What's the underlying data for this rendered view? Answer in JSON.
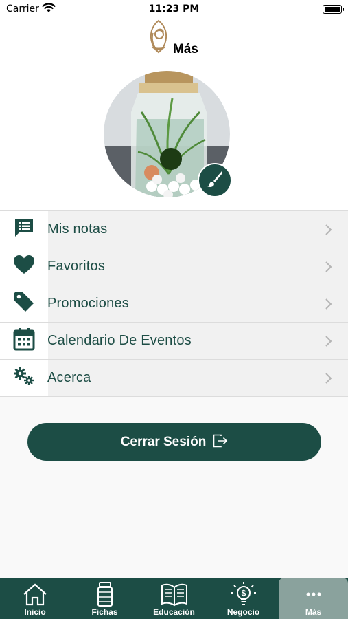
{
  "status_bar": {
    "carrier": "Carrier",
    "time": "11:23 PM"
  },
  "header": {
    "logo_icon": "brand-leaf-logo",
    "title": "Más"
  },
  "profile": {
    "avatar_icon": "profile-photo",
    "edit_icon": "paintbrush-icon"
  },
  "menu": {
    "items": [
      {
        "label": "Mis notas",
        "icon": "notes-icon"
      },
      {
        "label": "Favoritos",
        "icon": "heart-icon"
      },
      {
        "label": "Promociones",
        "icon": "tag-icon"
      },
      {
        "label": "Calendario De Eventos",
        "icon": "calendar-icon"
      },
      {
        "label": "Acerca",
        "icon": "gears-icon"
      }
    ]
  },
  "logout": {
    "label": "Cerrar Sesión",
    "icon": "logout-icon"
  },
  "tabs": [
    {
      "label": "Inicio",
      "icon": "home-icon"
    },
    {
      "label": "Fichas",
      "icon": "bottle-icon"
    },
    {
      "label": "Educación",
      "icon": "book-icon"
    },
    {
      "label": "Negocio",
      "icon": "lightbulb-dollar-icon"
    },
    {
      "label": "Más",
      "icon": "more-icon",
      "active": true
    }
  ],
  "colors": {
    "primary": "#1c4d45",
    "active_tab": "#8aa29d",
    "menu_row_bg": "#f1f1f1",
    "logo_gold": "#b08a5a"
  }
}
